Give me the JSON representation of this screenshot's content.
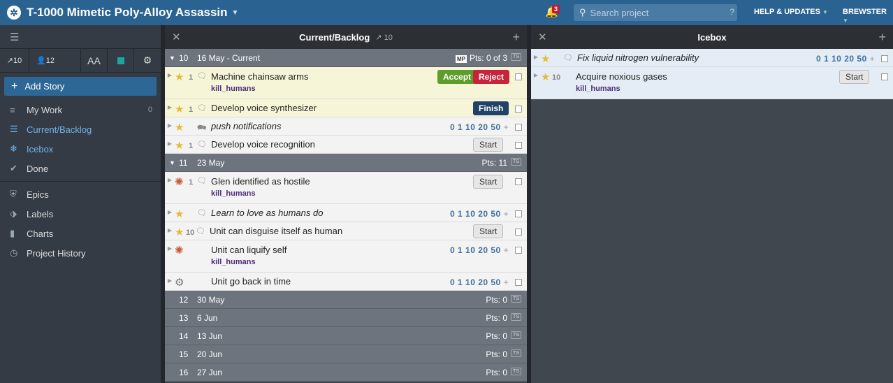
{
  "app": {
    "project_title": "T-1000 Mimetic Poly-Alloy Assassin",
    "notifications": "3",
    "search_placeholder": "Search project",
    "help": "HELP & UPDATES",
    "user": "BREWSTER"
  },
  "sidebar": {
    "velocity": "10",
    "members": "12",
    "font_icon": "AA",
    "add_story": "Add Story",
    "items": [
      {
        "label": "My Work",
        "count": "0"
      },
      {
        "label": "Current/Backlog"
      },
      {
        "label": "Icebox"
      },
      {
        "label": "Done"
      },
      {
        "label": "Epics"
      },
      {
        "label": "Labels"
      },
      {
        "label": "Charts"
      },
      {
        "label": "Project History"
      }
    ]
  },
  "backlog": {
    "title": "Current/Backlog",
    "velocity": "10",
    "iterations": [
      {
        "num": "10",
        "date": "16 May - Current",
        "mp": "MP",
        "pts": "Pts: 0 of 3",
        "ts": "TS"
      },
      {
        "num": "11",
        "date": "23 May",
        "pts": "Pts: 11",
        "ts": "TS"
      },
      {
        "num": "12",
        "date": "30 May",
        "pts": "Pts: 0",
        "ts": "TS"
      },
      {
        "num": "13",
        "date": "6 Jun",
        "pts": "Pts: 0",
        "ts": "TS"
      },
      {
        "num": "14",
        "date": "13 Jun",
        "pts": "Pts: 0",
        "ts": "TS"
      },
      {
        "num": "15",
        "date": "20 Jun",
        "pts": "Pts: 0",
        "ts": "TS"
      },
      {
        "num": "16",
        "date": "27 Jun",
        "pts": "Pts: 0",
        "ts": "TS"
      }
    ],
    "stories": [
      {
        "title": "Machine chainsaw arms",
        "est": "1",
        "label": "kill_humans",
        "accept": "Accept",
        "reject": "Reject"
      },
      {
        "title": "Develop voice synthesizer",
        "est": "1",
        "finish": "Finish"
      },
      {
        "title": "push notifications",
        "points": "0 1 10 20 50",
        "plus": "+"
      },
      {
        "title": "Develop voice recognition",
        "est": "1",
        "start": "Start"
      },
      {
        "title": "Glen identified as hostile",
        "est": "1",
        "label": "kill_humans",
        "start": "Start"
      },
      {
        "title": "Learn to love as humans do",
        "points": "0 1 10 20 50",
        "plus": "+"
      },
      {
        "title": "Unit can disguise itself as human",
        "est": "10",
        "start": "Start"
      },
      {
        "title": "Unit can liquify self",
        "label": "kill_humans",
        "points": "0 1 10 20 50",
        "plus": "+"
      },
      {
        "title": "Unit go back in time",
        "points": "0 1 10 20 50",
        "plus": "+"
      }
    ]
  },
  "icebox": {
    "title": "Icebox",
    "stories": [
      {
        "title": "Fix liquid nitrogen vulnerability",
        "points": "0 1 10 20 50",
        "plus": "+"
      },
      {
        "title": "Acquire noxious gases",
        "est": "10",
        "label": "kill_humans",
        "start": "Start"
      }
    ]
  }
}
